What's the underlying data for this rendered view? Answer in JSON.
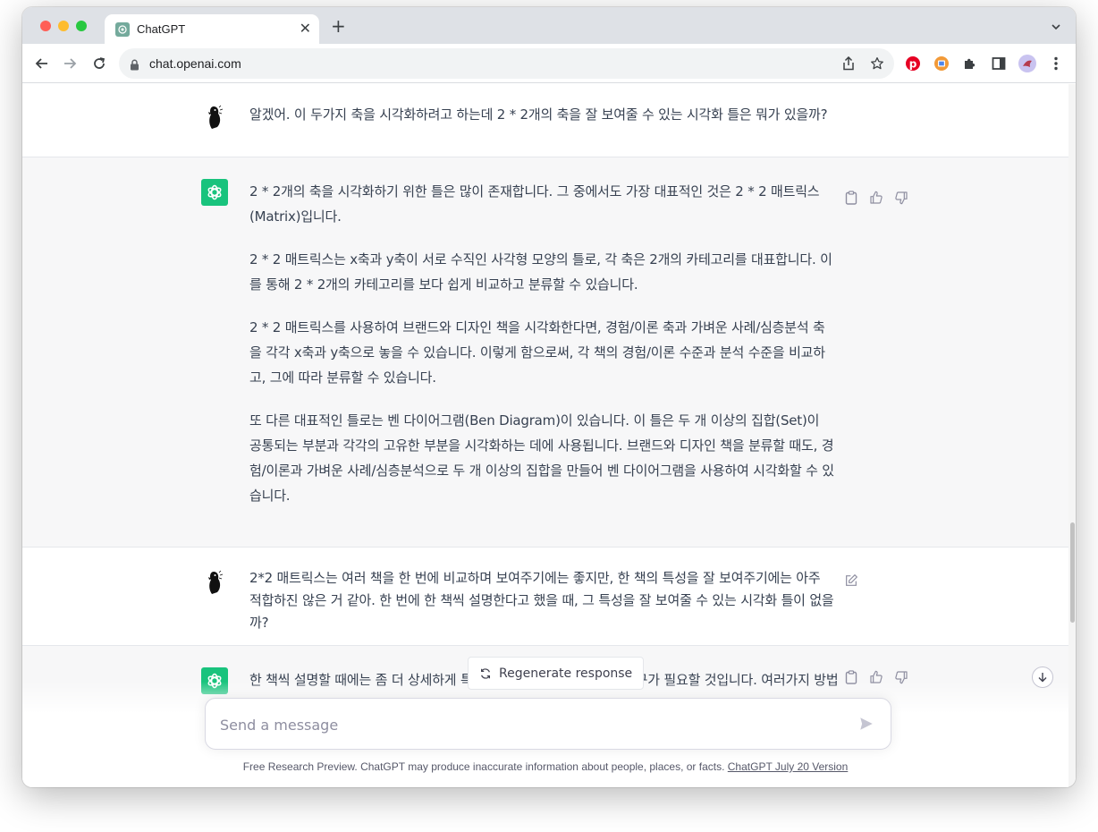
{
  "browser": {
    "tab_title": "ChatGPT",
    "tab_close": "✕",
    "new_tab": "+",
    "url": "chat.openai.com"
  },
  "messages": [
    {
      "role": "user",
      "paragraphs": [
        "알겠어. 이 두가지 축을 시각화하려고 하는데 2 * 2개의 축을 잘 보여줄 수 있는 시각화 틀은 뭐가 있을까?"
      ]
    },
    {
      "role": "assistant",
      "paragraphs": [
        "2 * 2개의 축을 시각화하기 위한 틀은 많이 존재합니다. 그 중에서도 가장 대표적인 것은 2 * 2 매트릭스(Matrix)입니다.",
        "2 * 2 매트릭스는 x축과 y축이 서로 수직인 사각형 모양의 틀로, 각 축은 2개의 카테고리를 대표합니다. 이를 통해 2 * 2개의 카테고리를 보다 쉽게 비교하고 분류할 수 있습니다.",
        "2 * 2 매트릭스를 사용하여 브랜드와 디자인 책을 시각화한다면, 경험/이론 축과 가벼운 사례/심층분석 축을 각각 x축과 y축으로 놓을 수 있습니다. 이렇게 함으로써, 각 책의 경험/이론 수준과 분석 수준을 비교하고, 그에 따라 분류할 수 있습니다.",
        "또 다른 대표적인 틀로는 벤 다이어그램(Ben Diagram)이 있습니다. 이 틀은 두 개 이상의 집합(Set)이 공통되는 부분과 각각의 고유한 부분을 시각화하는 데에 사용됩니다. 브랜드와 디자인 책을 분류할 때도, 경험/이론과 가벼운 사례/심층분석으로 두 개 이상의 집합을 만들어 벤 다이어그램을 사용하여 시각화할 수 있습니다."
      ]
    },
    {
      "role": "user",
      "paragraphs": [
        "2*2 매트릭스는 여러 책을 한 번에 비교하며 보여주기에는 좋지만, 한 책의 특성을 잘 보여주기에는 아주 적합하진 않은 거 같아. 한 번에 한 책씩 설명한다고 했을 때, 그 특성을 잘 보여줄 수 있는 시각화 틀이 없을까?"
      ]
    },
    {
      "role": "assistant",
      "paragraphs": [
        "한 책씩 설명할 때에는 좀 더 상세하게 특",
        "도구가 필요할 것입니다. 여러가지 방법"
      ]
    }
  ],
  "composer": {
    "regenerate_label": "Regenerate response",
    "placeholder": "Send a message",
    "footer_text": "Free Research Preview. ChatGPT may produce inaccurate information about people, places, or facts.",
    "footer_link": "ChatGPT July 20 Version"
  },
  "colors": {
    "gpt_green": "#19c37d",
    "user_bg": "#ffffff",
    "assistant_bg": "#f7f7f8"
  }
}
